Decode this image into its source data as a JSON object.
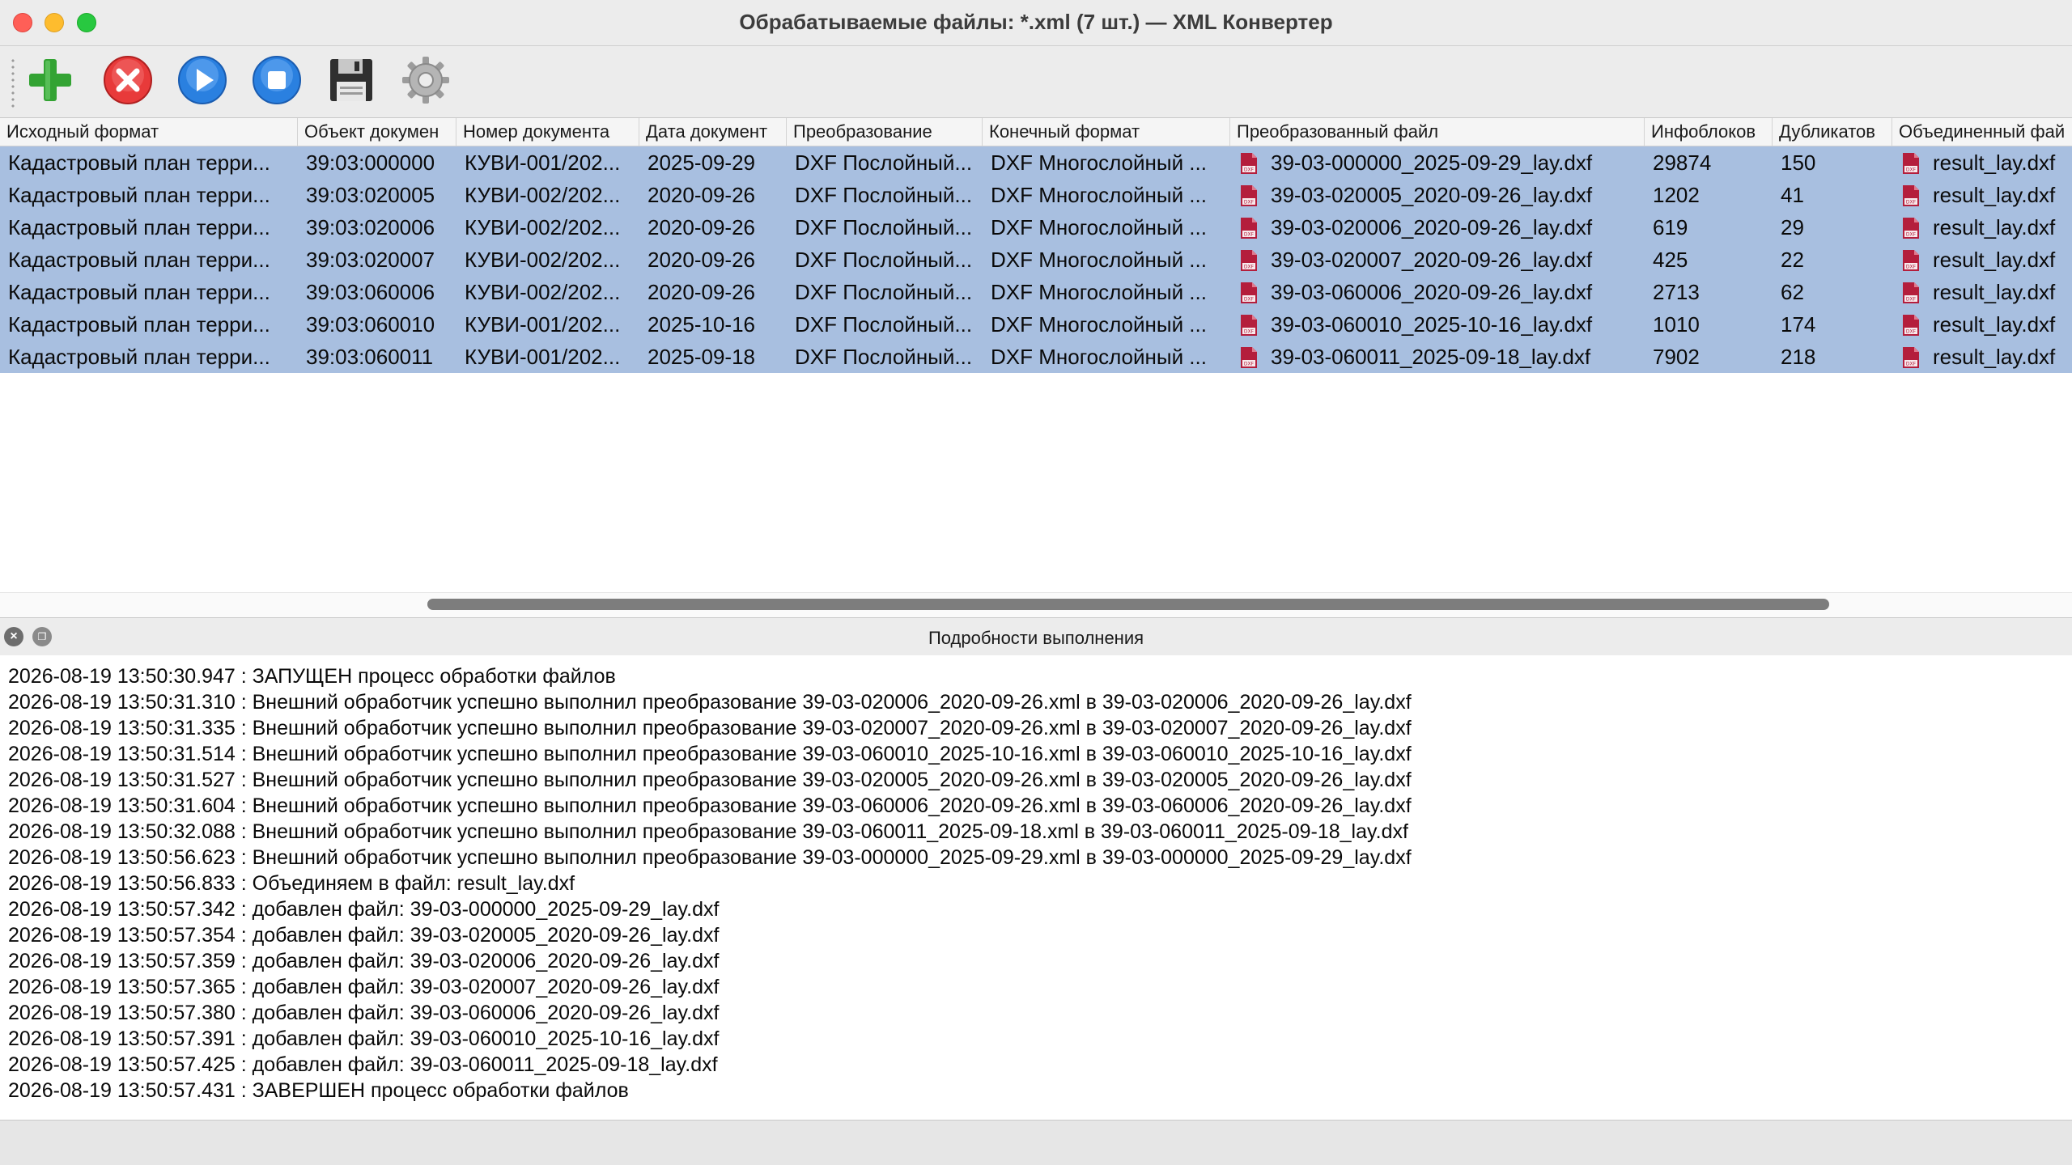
{
  "window": {
    "title": "Обрабатываемые файлы: *.xml (7 шт.) — XML Конвертер"
  },
  "toolbar": {
    "buttons": [
      {
        "name": "add",
        "icon": "plus-icon",
        "color": "#2e9e2e"
      },
      {
        "name": "remove",
        "icon": "close-icon",
        "color": "#e03030"
      },
      {
        "name": "run",
        "icon": "play-icon",
        "color": "#2a7de0"
      },
      {
        "name": "stop",
        "icon": "stop-icon",
        "color": "#2a7de0"
      },
      {
        "name": "save",
        "icon": "floppy-icon",
        "color": "#333333"
      },
      {
        "name": "settings",
        "icon": "gear-icon",
        "color": "#9a9a9a"
      }
    ]
  },
  "table": {
    "columns": [
      "Исходный формат",
      "Объект докумен",
      "Номер документа",
      "Дата документ",
      "Преобразование",
      "Конечный формат",
      "Преобразованный файл",
      "Инфоблоков",
      "Дубликатов",
      "Объединенный фай"
    ],
    "rows": [
      {
        "src": "Кадастровый план терри...",
        "obj": "39:03:000000",
        "num": "КУВИ-001/202...",
        "date": "2025-09-29",
        "conv": "DXF Послойный...",
        "fmt": "DXF Многослойный ...",
        "file": "39-03-000000_2025-09-29_lay.dxf",
        "info": "29874",
        "dup": "150",
        "merged": "result_lay.dxf"
      },
      {
        "src": "Кадастровый план терри...",
        "obj": "39:03:020005",
        "num": "КУВИ-002/202...",
        "date": "2020-09-26",
        "conv": "DXF Послойный...",
        "fmt": "DXF Многослойный ...",
        "file": "39-03-020005_2020-09-26_lay.dxf",
        "info": "1202",
        "dup": "41",
        "merged": "result_lay.dxf"
      },
      {
        "src": "Кадастровый план терри...",
        "obj": "39:03:020006",
        "num": "КУВИ-002/202...",
        "date": "2020-09-26",
        "conv": "DXF Послойный...",
        "fmt": "DXF Многослойный ...",
        "file": "39-03-020006_2020-09-26_lay.dxf",
        "info": "619",
        "dup": "29",
        "merged": "result_lay.dxf"
      },
      {
        "src": "Кадастровый план терри...",
        "obj": "39:03:020007",
        "num": "КУВИ-002/202...",
        "date": "2020-09-26",
        "conv": "DXF Послойный...",
        "fmt": "DXF Многослойный ...",
        "file": "39-03-020007_2020-09-26_lay.dxf",
        "info": "425",
        "dup": "22",
        "merged": "result_lay.dxf"
      },
      {
        "src": "Кадастровый план терри...",
        "obj": "39:03:060006",
        "num": "КУВИ-002/202...",
        "date": "2020-09-26",
        "conv": "DXF Послойный...",
        "fmt": "DXF Многослойный ...",
        "file": "39-03-060006_2020-09-26_lay.dxf",
        "info": "2713",
        "dup": "62",
        "merged": "result_lay.dxf"
      },
      {
        "src": "Кадастровый план терри...",
        "obj": "39:03:060010",
        "num": "КУВИ-001/202...",
        "date": "2025-10-16",
        "conv": "DXF Послойный...",
        "fmt": "DXF Многослойный ...",
        "file": "39-03-060010_2025-10-16_lay.dxf",
        "info": "1010",
        "dup": "174",
        "merged": "result_lay.dxf"
      },
      {
        "src": "Кадастровый план терри...",
        "obj": "39:03:060011",
        "num": "КУВИ-001/202...",
        "date": "2025-09-18",
        "conv": "DXF Послойный...",
        "fmt": "DXF Многослойный ...",
        "file": "39-03-060011_2025-09-18_lay.dxf",
        "info": "7902",
        "dup": "218",
        "merged": "result_lay.dxf"
      }
    ],
    "selection_color": "#a8bfe0"
  },
  "panel": {
    "title": "Подробности выполнения",
    "close_icon": "close-icon",
    "float_icon": "float-icon"
  },
  "log": [
    "2026-08-19 13:50:30.947 : ЗАПУЩЕН процесс обработки файлов",
    "2026-08-19 13:50:31.310 : Внешний обработчик успешно выполнил преобразование 39-03-020006_2020-09-26.xml в 39-03-020006_2020-09-26_lay.dxf",
    "2026-08-19 13:50:31.335 : Внешний обработчик успешно выполнил преобразование 39-03-020007_2020-09-26.xml в 39-03-020007_2020-09-26_lay.dxf",
    "2026-08-19 13:50:31.514 : Внешний обработчик успешно выполнил преобразование 39-03-060010_2025-10-16.xml в 39-03-060010_2025-10-16_lay.dxf",
    "2026-08-19 13:50:31.527 : Внешний обработчик успешно выполнил преобразование 39-03-020005_2020-09-26.xml в 39-03-020005_2020-09-26_lay.dxf",
    "2026-08-19 13:50:31.604 : Внешний обработчик успешно выполнил преобразование 39-03-060006_2020-09-26.xml в 39-03-060006_2020-09-26_lay.dxf",
    "2026-08-19 13:50:32.088 : Внешний обработчик успешно выполнил преобразование 39-03-060011_2025-09-18.xml в 39-03-060011_2025-09-18_lay.dxf",
    "2026-08-19 13:50:56.623 : Внешний обработчик успешно выполнил преобразование 39-03-000000_2025-09-29.xml в 39-03-000000_2025-09-29_lay.dxf",
    "2026-08-19 13:50:56.833 : Объединяем в файл: result_lay.dxf",
    "2026-08-19 13:50:57.342 : добавлен файл: 39-03-000000_2025-09-29_lay.dxf",
    "2026-08-19 13:50:57.354 : добавлен файл: 39-03-020005_2020-09-26_lay.dxf",
    "2026-08-19 13:50:57.359 : добавлен файл: 39-03-020006_2020-09-26_lay.dxf",
    "2026-08-19 13:50:57.365 : добавлен файл: 39-03-020007_2020-09-26_lay.dxf",
    "2026-08-19 13:50:57.380 : добавлен файл: 39-03-060006_2020-09-26_lay.dxf",
    "2026-08-19 13:50:57.391 : добавлен файл: 39-03-060010_2025-10-16_lay.dxf",
    "2026-08-19 13:50:57.425 : добавлен файл: 39-03-060011_2025-09-18_lay.dxf",
    "2026-08-19 13:50:57.431 : ЗАВЕРШЕН процесс обработки файлов"
  ]
}
